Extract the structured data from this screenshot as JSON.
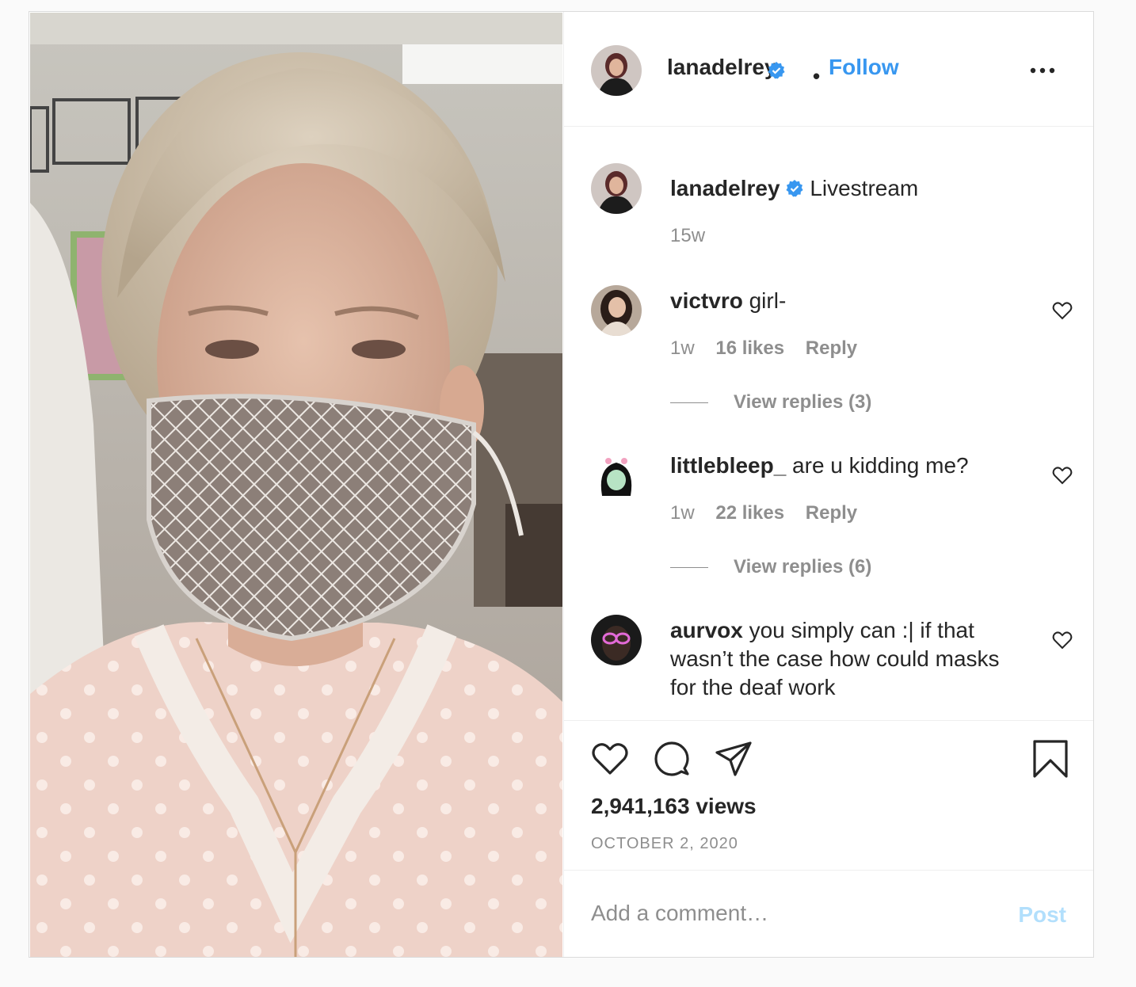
{
  "post": {
    "author": "lanadelrey",
    "follow_label": "Follow",
    "separator": "•",
    "more_icon": "more-horizontal-icon",
    "verified_icon": "verified-badge-icon"
  },
  "caption": {
    "author": "lanadelrey",
    "text": "Livestream",
    "time": "15w"
  },
  "comments": [
    {
      "author": "victvro",
      "text": "girl-",
      "time": "1w",
      "likes": "16 likes",
      "reply_label": "Reply",
      "view_replies": "View replies (3)"
    },
    {
      "author": "littlebleep_",
      "text": "are u kidding me?",
      "time": "1w",
      "likes": "22 likes",
      "reply_label": "Reply",
      "view_replies": "View replies (6)"
    },
    {
      "author": "aurvox",
      "text": "you simply can :| if that wasn’t the case how could masks for the deaf work"
    }
  ],
  "actions": {
    "views": "2,941,163 views",
    "date": "OCTOBER 2, 2020",
    "icons": [
      "heart-icon",
      "comment-icon",
      "share-icon",
      "bookmark-icon"
    ]
  },
  "comment_box": {
    "placeholder": "Add a comment…",
    "post_label": "Post"
  },
  "colors": {
    "link_blue": "#3897f0",
    "post_disabled": "#b2dffc",
    "muted": "#8e8e8e",
    "text": "#262626",
    "border": "#dbdbdb"
  }
}
